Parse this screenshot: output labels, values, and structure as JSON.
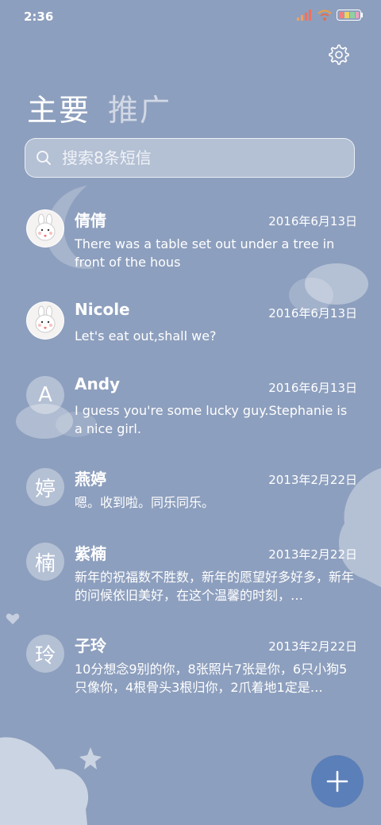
{
  "status_bar": {
    "time": "2:36"
  },
  "tabs": {
    "primary": "主要",
    "promo": "推广"
  },
  "search": {
    "placeholder": "搜索8条短信"
  },
  "conversations": [
    {
      "name": "倩倩",
      "date": "2016年6月13日",
      "preview": "There was a table set out under a tree in front of the hous",
      "avatar": "bunny-photo"
    },
    {
      "name": "Nicole",
      "date": "2016年6月13日",
      "preview": "Let's eat out,shall we?",
      "avatar": "bunny-photo"
    },
    {
      "name": "Andy",
      "date": "2016年6月13日",
      "preview": "I guess you're some lucky guy.Stephanie is a nice girl.",
      "avatar_letter": "A"
    },
    {
      "name": "燕婷",
      "date": "2013年2月22日",
      "preview": "嗯。收到啦。同乐同乐。",
      "avatar_letter": "婷"
    },
    {
      "name": "紫楠",
      "date": "2013年2月22日",
      "preview": "新年的祝福数不胜数，新年的愿望好多好多，新年的问候依旧美好，在这个温馨的时刻，…",
      "avatar_letter": "楠"
    },
    {
      "name": "子玲",
      "date": "2013年2月22日",
      "preview": "10分想念9别的你，8张照片7张是你，6只小狗5只像你，4根骨头3根归你，2爪着地1定是…",
      "avatar_letter": "玲"
    }
  ],
  "icons": {
    "settings": "gear-icon",
    "search": "search-icon",
    "fab": "plus-icon"
  },
  "colors": {
    "background": "#8d9fbe",
    "fab": "#5b7fb8"
  }
}
